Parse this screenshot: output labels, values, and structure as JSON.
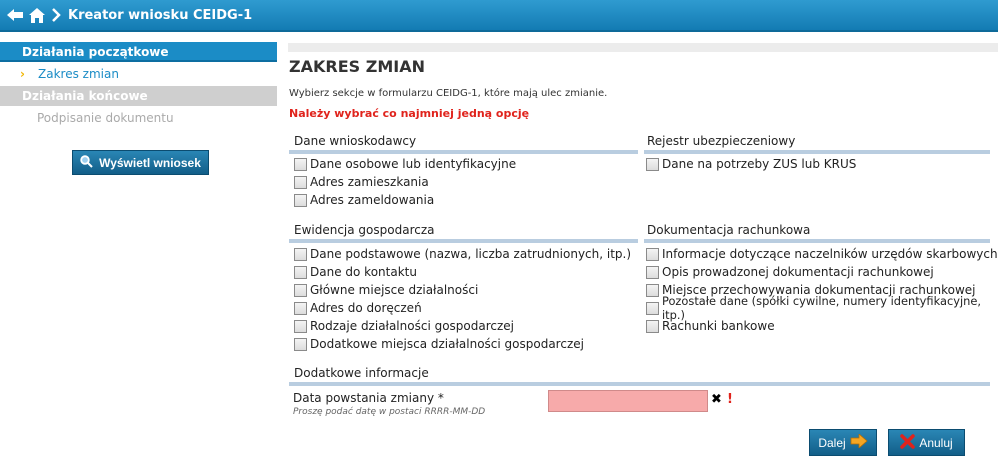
{
  "header": {
    "title": "Kreator wniosku CEIDG-1"
  },
  "sidebar": {
    "section1": "Działania początkowe",
    "current_item": "Zakres zmian",
    "section2": "Działania końcowe",
    "muted_item": "Podpisanie dokumentu",
    "view_button": "Wyświetl wniosek"
  },
  "main": {
    "title": "ZAKRES ZMIAN",
    "intro": "Wybierz sekcje w formularzu CEIDG-1, które mają ulec zmianie.",
    "warning": "Należy wybrać co najmniej jedną opcję"
  },
  "sections": {
    "applicant": {
      "title": "Dane wnioskodawcy",
      "options": [
        "Dane osobowe lub identyfikacyjne",
        "Adres zamieszkania",
        "Adres zameldowania"
      ]
    },
    "insurance": {
      "title": "Rejestr ubezpieczeniowy",
      "options": [
        "Dane na potrzeby ZUS lub KRUS"
      ]
    },
    "business": {
      "title": "Ewidencja gospodarcza",
      "options": [
        "Dane podstawowe (nazwa, liczba zatrudnionych, itp.)",
        "Dane do kontaktu",
        "Główne miejsce działalności",
        "Adres do doręczeń",
        "Rodzaje działalności gospodarczej",
        "Dodatkowe miejsca działalności gospodarczej"
      ]
    },
    "accounting": {
      "title": "Dokumentacja rachunkowa",
      "options": [
        "Informacje dotyczące naczelników urzędów skarbowych",
        "Opis prowadzonej dokumentacji rachunkowej",
        "Miejsce przechowywania dokumentacji rachunkowej",
        "Pozostałe dane (spółki cywilne, numery identyfikacyjne, itp.)",
        "Rachunki bankowe"
      ]
    },
    "additional": {
      "title": "Dodatkowe informacje",
      "date_label": "Data powstania zmiany *",
      "date_hint": "Proszę podać datę w postaci RRRR-MM-DD",
      "date_value": ""
    }
  },
  "buttons": {
    "next": "Dalej",
    "cancel": "Anuluj"
  },
  "colors": {
    "accent": "#1b8cc6",
    "error": "#e0231c",
    "input_error_bg": "#f7aaaa"
  }
}
